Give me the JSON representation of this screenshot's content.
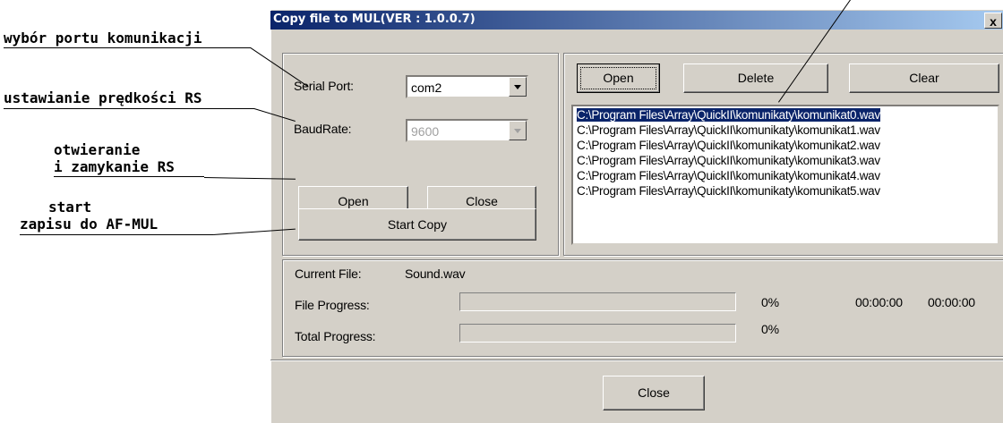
{
  "annotations": {
    "serial_port": "wybór portu komunikacji",
    "baud": "ustawianie prędkości RS",
    "open_close_1": "otwieranie",
    "open_close_2": "i zamykanie RS",
    "start_1": "start",
    "start_2": "zapisu do AF-MUL"
  },
  "window": {
    "title": "Copy file to MUL(VER : 1.0.0.7)",
    "close_glyph": "x"
  },
  "serial": {
    "port_label": "Serial Port:",
    "port_value": "com2",
    "baud_label": "BaudRate:",
    "baud_value": "9600",
    "open_label": "Open",
    "close_label": "Close",
    "start_copy_label": "Start Copy"
  },
  "files": {
    "open_label": "Open",
    "delete_label": "Delete",
    "clear_label": "Clear",
    "items": [
      "C:\\Program Files\\Array\\QuickII\\komunikaty\\komunikat0.wav",
      "C:\\Program Files\\Array\\QuickII\\komunikaty\\komunikat1.wav",
      "C:\\Program Files\\Array\\QuickII\\komunikaty\\komunikat2.wav",
      "C:\\Program Files\\Array\\QuickII\\komunikaty\\komunikat3.wav",
      "C:\\Program Files\\Array\\QuickII\\komunikaty\\komunikat4.wav",
      "C:\\Program Files\\Array\\QuickII\\komunikaty\\komunikat5.wav"
    ],
    "selected_index": 0
  },
  "status": {
    "current_file_label": "Current File:",
    "current_file_value": "Sound.wav",
    "file_progress_label": "File Progress:",
    "file_progress_pct": "0%",
    "file_progress_value": 0,
    "time_elapsed": "00:00:00",
    "time_total": "00:00:00",
    "total_progress_label": "Total Progress:",
    "total_progress_pct": "0%",
    "total_progress_value": 0
  },
  "footer": {
    "close_label": "Close"
  },
  "colors": {
    "title_start": "#0a246a",
    "title_end": "#a6caf0",
    "face": "#d4d0c8",
    "selection": "#0a246a"
  }
}
